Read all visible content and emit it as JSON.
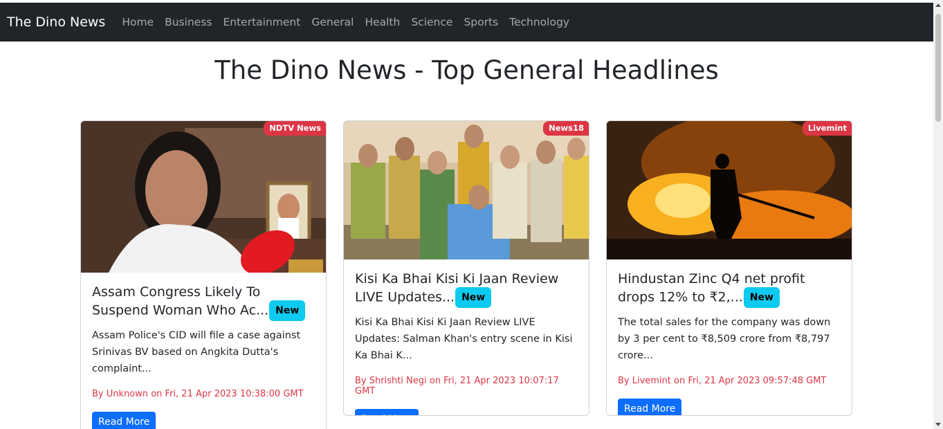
{
  "navbar": {
    "brand": "The Dino News",
    "links": [
      "Home",
      "Business",
      "Entertainment",
      "General",
      "Health",
      "Science",
      "Sports",
      "Technology"
    ]
  },
  "page_title": "The Dino News - Top General Headlines",
  "new_label": "New",
  "read_more_label": "Read More",
  "cards": [
    {
      "source": "NDTV News",
      "title": "Assam Congress Likely To Suspend Woman Who Ac...",
      "description": "Assam Police's CID will file a case against Srinivas BV based on Angkita Dutta's complaint...",
      "meta": "By Unknown on Fri, 21 Apr 2023 10:38:00 GMT"
    },
    {
      "source": "News18",
      "title": "Kisi Ka Bhai Kisi Ki Jaan Review LIVE Updates...",
      "description": "Kisi Ka Bhai Kisi Ki Jaan Review LIVE Updates: Salman Khan's entry scene in Kisi Ka Bhai K...",
      "meta": "By Shrishti Negi on Fri, 21 Apr 2023 10:07:17 GMT"
    },
    {
      "source": "Livemint",
      "title": "Hindustan Zinc Q4 net profit drops 12% to ₹2,...",
      "description": "The total sales for the company was down by 3 per cent to ₹8,509 crore from ₹8,797 crore...",
      "meta": "By Livemint on Fri, 21 Apr 2023 09:57:48 GMT"
    }
  ],
  "colors": {
    "navbar_bg": "#212529",
    "source_badge": "#dc3545",
    "new_badge": "#0dcaf0",
    "button": "#0d6efd",
    "meta_text": "#dc3545"
  }
}
